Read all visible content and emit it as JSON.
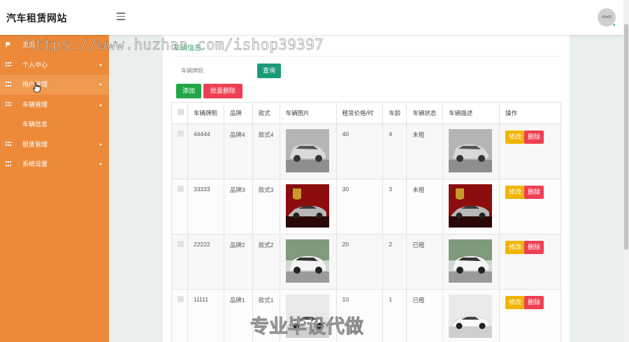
{
  "header": {
    "title": "汽车租赁网站",
    "avatar_text": "60x60"
  },
  "sidebar": {
    "items": [
      {
        "label": "主页",
        "icon": "flag-icon"
      },
      {
        "label": "个人中心",
        "icon": "grid-icon"
      },
      {
        "label": "用户管理",
        "icon": "grid-icon"
      },
      {
        "label": "车辆管理",
        "icon": "grid-icon",
        "sub": "车辆信息"
      },
      {
        "label": "租赁管理",
        "icon": "grid-icon"
      },
      {
        "label": "系统设置",
        "icon": "grid-icon"
      }
    ]
  },
  "panel": {
    "title": "车辆信息"
  },
  "search": {
    "placeholder": "车辆牌照",
    "button": "查询"
  },
  "toolbar": {
    "add": "添加",
    "batch_delete": "批量删除"
  },
  "table": {
    "headers": [
      "车辆牌照",
      "品牌",
      "款式",
      "车辆图片",
      "租赁价格/时",
      "车龄",
      "车辆状态",
      "车辆描述",
      "操作"
    ],
    "rows": [
      {
        "plate": "44444",
        "brand": "品牌4",
        "style": "款式4",
        "price": "40",
        "age": "4",
        "status": "未租",
        "car": "silver-suv"
      },
      {
        "plate": "33333",
        "brand": "品牌3",
        "style": "款式3",
        "price": "30",
        "age": "3",
        "status": "未租",
        "car": "porsche"
      },
      {
        "plate": "22222",
        "brand": "品牌2",
        "style": "款式2",
        "price": "20",
        "age": "2",
        "status": "已租",
        "car": "white-suv"
      },
      {
        "plate": "11111",
        "brand": "品牌1",
        "style": "款式1",
        "price": "10",
        "age": "1",
        "status": "已租",
        "car": "white-coupe"
      }
    ],
    "edit_label": "修改",
    "delete_label": "删除"
  },
  "watermarks": {
    "url": "https://www.huzhan.com/ishop39397",
    "text": "专业毕设代做"
  },
  "colors": {
    "sidebar": "#ed8a39",
    "accent_green": "#2fae6c",
    "search_btn": "#1a9a78",
    "add_btn": "#22a648",
    "danger": "#ee3f53",
    "edit_btn": "#f0b500"
  }
}
